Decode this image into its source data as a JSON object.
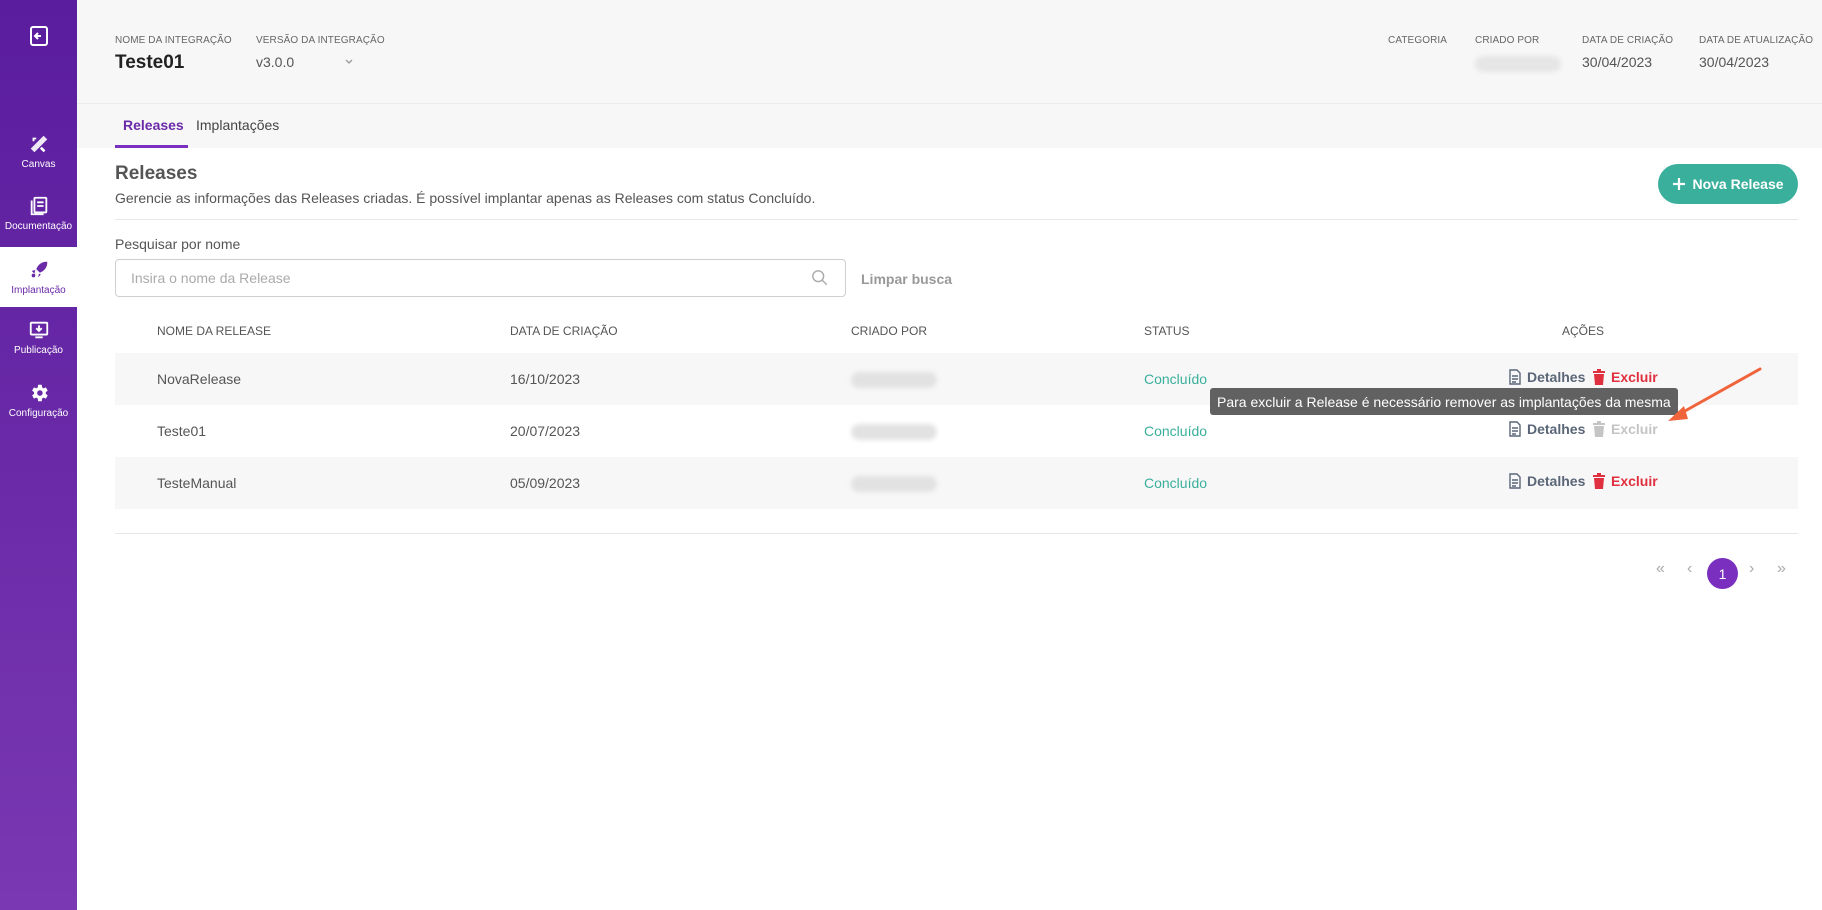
{
  "sidebar": {
    "items": [
      {
        "label": "Canvas",
        "icon": "canvas-icon"
      },
      {
        "label": "Documentação",
        "icon": "documentation-icon"
      },
      {
        "label": "Implantação",
        "icon": "rocket-icon"
      },
      {
        "label": "Publicação",
        "icon": "publish-icon"
      },
      {
        "label": "Configuração",
        "icon": "gear-icon"
      }
    ],
    "active": "Implantação"
  },
  "header": {
    "name_key": "NOME DA INTEGRAÇÃO",
    "name_value": "Teste01",
    "version_key": "VERSÃO DA INTEGRAÇÃO",
    "version_value": "v3.0.0",
    "category_key": "CATEGORIA",
    "created_by_key": "CRIADO POR",
    "created_date_key": "DATA DE CRIAÇÃO",
    "created_date_value": "30/04/2023",
    "updated_date_key": "DATA DE ATUALIZAÇÃO",
    "updated_date_value": "30/04/2023"
  },
  "tabs": [
    {
      "label": "Releases",
      "active": true
    },
    {
      "label": "Implantações",
      "active": false
    }
  ],
  "section": {
    "title": "Releases",
    "subtitle": "Gerencie as informações das Releases criadas. É possível implantar apenas as Releases com status Concluído.",
    "new_button": "Nova Release"
  },
  "search": {
    "label": "Pesquisar por nome",
    "placeholder": "Insira o nome da Release",
    "value": "",
    "clear_label": "Limpar busca"
  },
  "table": {
    "headers": [
      "NOME DA RELEASE",
      "DATA DE CRIAÇÃO",
      "CRIADO POR",
      "STATUS",
      "AÇÕES"
    ],
    "rows": [
      {
        "name": "NovaRelease",
        "date": "16/10/2023",
        "status": "Concluído",
        "details": "Detalhes",
        "delete": "Excluir",
        "delete_enabled": true
      },
      {
        "name": "Teste01",
        "date": "20/07/2023",
        "status": "Concluído",
        "details": "Detalhes",
        "delete": "Excluir",
        "delete_enabled": false
      },
      {
        "name": "TesteManual",
        "date": "05/09/2023",
        "status": "Concluído",
        "details": "Detalhes",
        "delete": "Excluir",
        "delete_enabled": true
      }
    ]
  },
  "tooltip": "Para excluir a Release é necessário remover as implantações da mesma",
  "pagination": {
    "first": "«",
    "prev": "‹",
    "current": "1",
    "next": "›",
    "last": "»"
  },
  "colors": {
    "brand": "#6a2aa8",
    "accent": "#3aaf9c",
    "danger": "#e0303f",
    "annotation": "#f0643c"
  }
}
